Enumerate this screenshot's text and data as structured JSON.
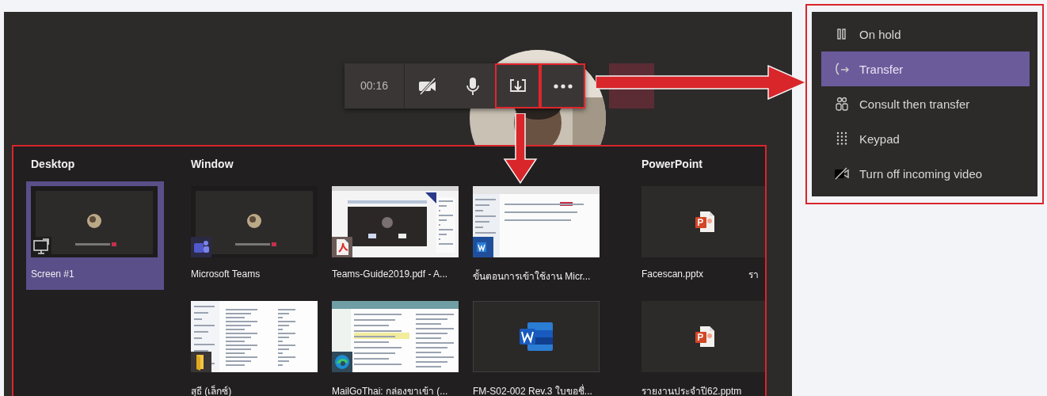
{
  "call_controls": {
    "timer": "00:16",
    "buttons": [
      {
        "kind": "camera-off",
        "highlighted": false,
        "dimmed": false
      },
      {
        "kind": "mic",
        "highlighted": false,
        "dimmed": false
      },
      {
        "kind": "share",
        "highlighted": true,
        "dimmed": false
      },
      {
        "kind": "more",
        "highlighted": true,
        "dimmed": false
      },
      {
        "kind": "end-call",
        "highlighted": false,
        "dimmed": true
      }
    ]
  },
  "share_tray": {
    "sections": [
      {
        "heading": "Desktop",
        "items": [
          {
            "label": "Screen #1",
            "thumbnail": {
              "kind": "call"
            },
            "badge": {
              "kind": "monitor"
            },
            "selected": true
          }
        ]
      },
      {
        "heading": "Window",
        "items": [
          {
            "label": "Microsoft Teams",
            "thumbnail": {
              "kind": "call"
            },
            "badge": {
              "kind": "teams"
            },
            "selected": false
          },
          {
            "label": "Teams-Guide2019.pdf - A...",
            "thumbnail": {
              "kind": "pdf"
            },
            "badge": {
              "kind": "pdf"
            },
            "selected": false
          },
          {
            "label": "ขั้นตอนการเข้าใช้งาน Micr...",
            "thumbnail": {
              "kind": "web"
            },
            "badge": {
              "kind": "word"
            },
            "selected": false
          },
          {
            "label": "สุธี (เล็กซ์)",
            "thumbnail": {
              "kind": "files"
            },
            "badge": {
              "kind": "folder"
            },
            "selected": false
          },
          {
            "label": "MailGoThai: กล่องขาเข้า (...",
            "thumbnail": {
              "kind": "email"
            },
            "badge": {
              "kind": "edge"
            },
            "selected": false
          },
          {
            "label": "FM-S02-002 Rev.3 ใบขอชื่...",
            "thumbnail": {
              "kind": "word-file"
            },
            "selected": false
          }
        ]
      },
      {
        "heading": "PowerPoint",
        "items": [
          {
            "label": "Facescan.pptx",
            "thumbnail": {
              "kind": "ppt-file"
            },
            "selected": false
          },
          {
            "label": "รายงานประจำปี62.pptm",
            "thumbnail": {
              "kind": "ppt-file"
            },
            "selected": false
          }
        ]
      }
    ],
    "cut_label": "รา"
  },
  "more_menu": {
    "items": [
      {
        "kind": "hold",
        "label": "On hold",
        "selected": false
      },
      {
        "kind": "transfer",
        "label": "Transfer",
        "selected": true
      },
      {
        "kind": "consult",
        "label": "Consult then transfer",
        "selected": false
      },
      {
        "kind": "keypad",
        "label": "Keypad",
        "selected": false
      },
      {
        "kind": "video-off",
        "label": "Turn off incoming video",
        "selected": false
      }
    ]
  }
}
